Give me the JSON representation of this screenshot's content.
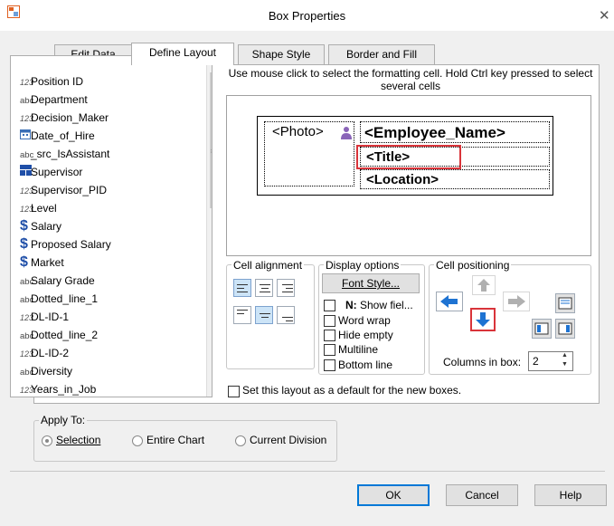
{
  "window": {
    "title": "Box Properties"
  },
  "tabs": [
    {
      "label": "Edit Data"
    },
    {
      "label": "Define Layout"
    },
    {
      "label": "Shape Style"
    },
    {
      "label": "Border and Fill"
    }
  ],
  "fields": [
    {
      "icon": "123",
      "label": "Position ID"
    },
    {
      "icon": "abc",
      "label": "Department"
    },
    {
      "icon": "123",
      "label": "Decision_Maker"
    },
    {
      "icon": "date-icon",
      "label": "Date_of_Hire"
    },
    {
      "icon": "abc",
      "label": "_src_IsAssistant"
    },
    {
      "icon": "supervisor-icon",
      "label": "Supervisor"
    },
    {
      "icon": "123",
      "label": "Supervisor_PID"
    },
    {
      "icon": "123",
      "label": "Level"
    },
    {
      "icon": "$",
      "label": "Salary"
    },
    {
      "icon": "$",
      "label": "Proposed Salary"
    },
    {
      "icon": "$",
      "label": "Market"
    },
    {
      "icon": "abc",
      "label": "Salary Grade"
    },
    {
      "icon": "abc",
      "label": "Dotted_line_1"
    },
    {
      "icon": "123",
      "label": "DL-ID-1"
    },
    {
      "icon": "abc",
      "label": "Dotted_line_2"
    },
    {
      "icon": "123",
      "label": "DL-ID-2"
    },
    {
      "icon": "abc",
      "label": "Diversity"
    },
    {
      "icon": "123",
      "label": "Years_in_Job"
    }
  ],
  "instruction": "Use mouse click to select the formatting cell. Hold Ctrl key pressed to select several cells",
  "preview": {
    "photo": "<Photo>",
    "name": "<Employee_Name>",
    "title": "<Title>",
    "location": "<Location>"
  },
  "cell_alignment": {
    "label": "Cell alignment"
  },
  "display_options": {
    "label": "Display options",
    "font_style": "Font Style...",
    "n_label": "N:",
    "show_field": "Show fiel...",
    "word_wrap": "Word wrap",
    "hide_empty": "Hide empty",
    "multiline": "Multiline",
    "bottom_line": "Bottom line"
  },
  "cell_positioning": {
    "label": "Cell positioning",
    "columns_label": "Columns in box:",
    "columns_value": "2"
  },
  "default_checkbox": "Set this layout as a default for the new boxes.",
  "apply_to": {
    "label": "Apply To:",
    "options": [
      "Selection",
      "Entire Chart",
      "Current Division"
    ],
    "selected": "Selection"
  },
  "buttons": {
    "ok": "OK",
    "cancel": "Cancel",
    "help": "Help"
  },
  "colors": {
    "accent": "#0078d7",
    "highlight": "#d9343a",
    "arrow_blue": "#1e73d2"
  }
}
